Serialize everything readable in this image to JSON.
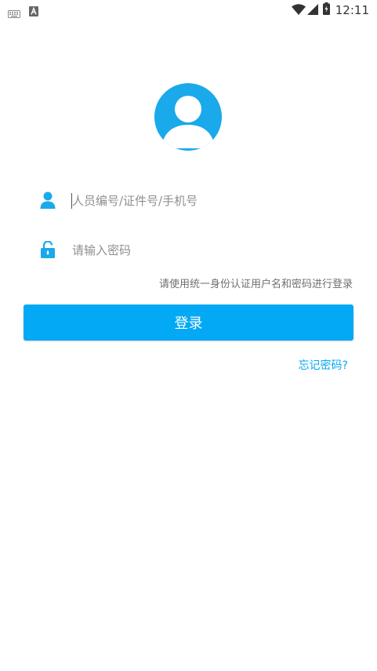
{
  "status_bar": {
    "time": "12:11",
    "icons": [
      "keyboard-icon",
      "a-icon",
      "wifi-icon",
      "signal-icon",
      "battery-icon"
    ]
  },
  "login": {
    "username_placeholder": "人员编号/证件号/手机号",
    "password_placeholder": "请输入密码",
    "hint": "请使用统一身份认证用户名和密码进行登录",
    "login_button": "登录",
    "forgot_password": "忘记密码?"
  },
  "colors": {
    "accent": "#03a9f4",
    "hint_text": "#6f6f6f",
    "placeholder": "#8f8f8f",
    "background": "#ffffff"
  }
}
